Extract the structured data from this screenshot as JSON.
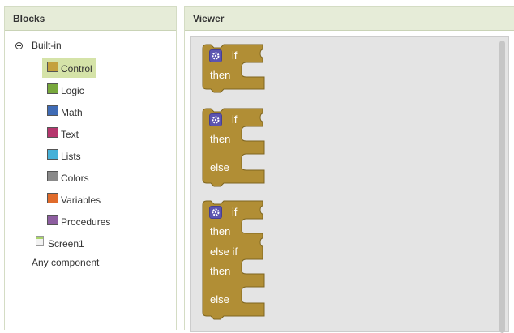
{
  "blocks_panel": {
    "title": "Blocks",
    "tree": {
      "root_label": "Built-in",
      "categories": [
        {
          "label": "Control",
          "color": "#c4a13c",
          "selected": true
        },
        {
          "label": "Logic",
          "color": "#78a83c"
        },
        {
          "label": "Math",
          "color": "#3f6bb5"
        },
        {
          "label": "Text",
          "color": "#b5366d"
        },
        {
          "label": "Lists",
          "color": "#47b1d8"
        },
        {
          "label": "Colors",
          "color": "#8a8a8a"
        },
        {
          "label": "Variables",
          "color": "#e06b2b"
        },
        {
          "label": "Procedures",
          "color": "#8d5ea0"
        }
      ],
      "screen_label": "Screen1",
      "any_component_label": "Any component"
    }
  },
  "viewer": {
    "title": "Viewer",
    "block_color": "#b18e35",
    "blocks": [
      {
        "kind": "if_then",
        "labels": [
          "if",
          "then"
        ]
      },
      {
        "kind": "if_then_else",
        "labels": [
          "if",
          "then",
          "else"
        ]
      },
      {
        "kind": "if_then_elseif_else",
        "labels": [
          "if",
          "then",
          "else if",
          "then",
          "else"
        ]
      }
    ]
  },
  "icons": {
    "collapse": "minus-circle-icon",
    "mutator": "gear-icon",
    "screen": "screen-icon"
  }
}
